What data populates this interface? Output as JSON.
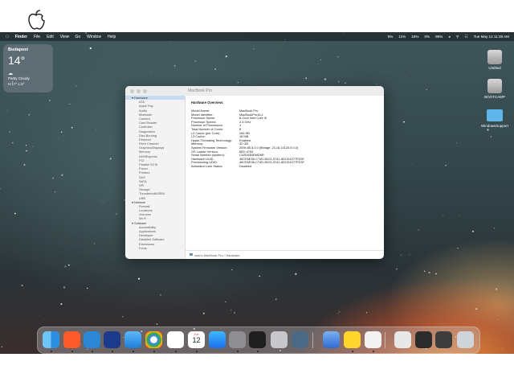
{
  "menubar": {
    "apple": "",
    "app": "Finder",
    "menus": [
      "File",
      "Edit",
      "View",
      "Go",
      "Window",
      "Help"
    ],
    "status": [
      "5%",
      "11%",
      "16%",
      "0%",
      "96%"
    ],
    "clock": "Tue May 12  11:28 AM"
  },
  "weather": {
    "city": "Budapest",
    "temp": "14°",
    "condition": "Partly Cloudy",
    "hilo": "H:17° L:8°"
  },
  "desktop_icons": [
    "Untitled",
    "BOOTCAMP",
    "WindowsSupport"
  ],
  "window": {
    "title": "MacBook Pro",
    "sidebar": [
      {
        "label": "▾ Hardware",
        "kind": "sec",
        "selected": true
      },
      {
        "label": "ATA",
        "kind": "sub"
      },
      {
        "label": "Apple Pay",
        "kind": "sub"
      },
      {
        "label": "Audio",
        "kind": "sub"
      },
      {
        "label": "Bluetooth",
        "kind": "sub"
      },
      {
        "label": "Camera",
        "kind": "sub"
      },
      {
        "label": "Card Reader",
        "kind": "sub"
      },
      {
        "label": "Controller",
        "kind": "sub"
      },
      {
        "label": "Diagnostics",
        "kind": "sub"
      },
      {
        "label": "Disc Burning",
        "kind": "sub"
      },
      {
        "label": "Ethernet",
        "kind": "sub"
      },
      {
        "label": "Fibre Channel",
        "kind": "sub"
      },
      {
        "label": "Graphics/Displays",
        "kind": "sub"
      },
      {
        "label": "Memory",
        "kind": "sub"
      },
      {
        "label": "NVMExpress",
        "kind": "sub"
      },
      {
        "label": "PCI",
        "kind": "sub"
      },
      {
        "label": "Parallel SCSI",
        "kind": "sub"
      },
      {
        "label": "Power",
        "kind": "sub"
      },
      {
        "label": "Printers",
        "kind": "sub"
      },
      {
        "label": "SAS",
        "kind": "sub"
      },
      {
        "label": "SATA",
        "kind": "sub"
      },
      {
        "label": "SPI",
        "kind": "sub"
      },
      {
        "label": "Storage",
        "kind": "sub"
      },
      {
        "label": "Thunderbolt/USB4",
        "kind": "sub"
      },
      {
        "label": "USB",
        "kind": "sub"
      },
      {
        "label": "▾ Network",
        "kind": "sec"
      },
      {
        "label": "Firewall",
        "kind": "sub"
      },
      {
        "label": "Locations",
        "kind": "sub"
      },
      {
        "label": "Volumes",
        "kind": "sub"
      },
      {
        "label": "Wi-Fi",
        "kind": "sub"
      },
      {
        "label": "▾ Software",
        "kind": "sec"
      },
      {
        "label": "Accessibility",
        "kind": "sub"
      },
      {
        "label": "Applications",
        "kind": "sub"
      },
      {
        "label": "Developer",
        "kind": "sub"
      },
      {
        "label": "Disabled Software",
        "kind": "sub"
      },
      {
        "label": "Extensions",
        "kind": "sub"
      },
      {
        "label": "Fonts",
        "kind": "sub"
      }
    ],
    "heading": "Hardware Overview:",
    "overview": [
      {
        "k": "Model Name:",
        "v": "MacBook Pro"
      },
      {
        "k": "Model Identifier:",
        "v": "MacBookPro16,1"
      },
      {
        "k": "Processor Name:",
        "v": "8-Core Intel Core i9"
      },
      {
        "k": "Processor Speed:",
        "v": "2.4 GHz"
      },
      {
        "k": "Number of Processors:",
        "v": "1"
      },
      {
        "k": "Total Number of Cores:",
        "v": "8"
      },
      {
        "k": "L2 Cache (per Core):",
        "v": "256 KB"
      },
      {
        "k": "L3 Cache:",
        "v": "16 MB"
      },
      {
        "k": "Hyper-Threading Technology:",
        "v": "Enabled"
      },
      {
        "k": "Memory:",
        "v": "32 GB"
      },
      {
        "k": "System Firmware Version:",
        "v": "2094.80.5.0.0 (iBridge: 23.16.13120.0.0,0)"
      },
      {
        "k": "OS Loader Version:",
        "v": "583~4762"
      },
      {
        "k": "Serial Number (system):",
        "v": "C02D93NEMD6R"
      },
      {
        "k": "Hardware UUID:",
        "v": "46CFAE36-C74D-5D21-9741-6DCD1077FD3F"
      },
      {
        "k": "Provisioning UDID:",
        "v": "46CFAE36-C74D-5D21-9741-6DCD1077FD3F"
      },
      {
        "k": "Activation Lock Status:",
        "v": "Disabled"
      }
    ],
    "path": "user's MacBook Pro › Hardware"
  },
  "dock": [
    "Finder",
    "Brave",
    "Visual Studio Code",
    "Terminal",
    "Mail",
    "Chrome",
    "Reminders",
    "Calendar",
    "App Store",
    "System Settings",
    "Activity Monitor",
    "Disk Utility",
    "Network Radar",
    "Preview",
    "Notes",
    "Keychain",
    "Printer",
    "Screenshot",
    "Mail Draft",
    "Trash"
  ],
  "calendar_icon": {
    "month": "Tue",
    "day": "12"
  }
}
